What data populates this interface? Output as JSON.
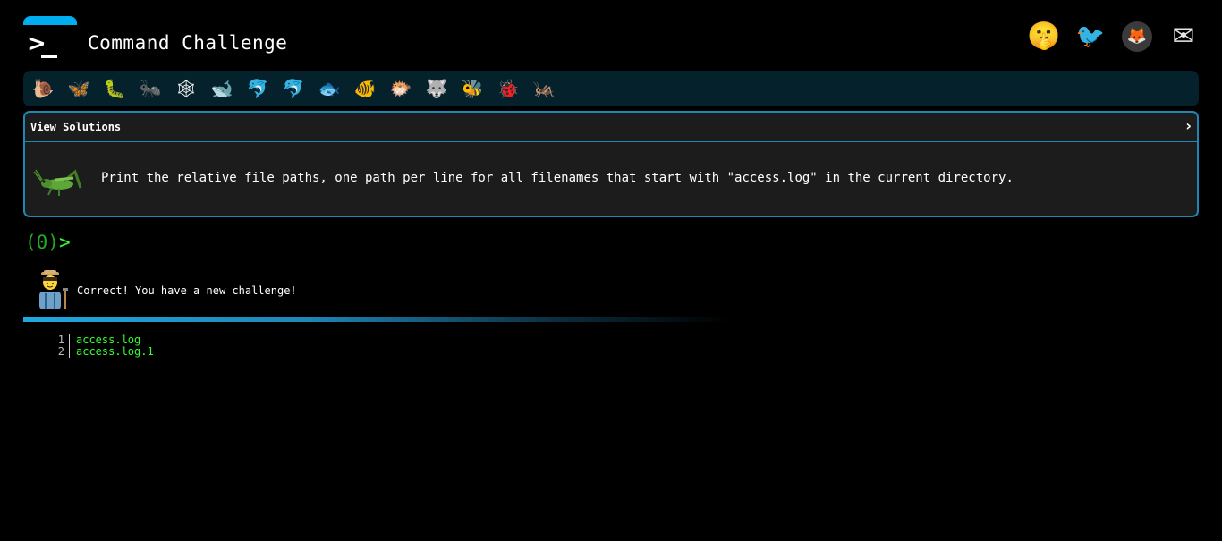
{
  "header": {
    "title": "Command Challenge",
    "social": [
      {
        "name": "shushing-face-icon",
        "glyph": "🤫"
      },
      {
        "name": "twitter-icon",
        "glyph": "🐦"
      },
      {
        "name": "gitlab-icon",
        "glyph": "🦊"
      },
      {
        "name": "mail-icon",
        "glyph": "✉"
      }
    ]
  },
  "critters": [
    {
      "name": "snail-icon",
      "glyph": "🐌"
    },
    {
      "name": "butterfly-icon",
      "glyph": "🦋"
    },
    {
      "name": "bug-icon",
      "glyph": "🐛"
    },
    {
      "name": "ant-icon",
      "glyph": "🐜"
    },
    {
      "name": "spiderweb-icon",
      "glyph": "🕸"
    },
    {
      "name": "whale-icon",
      "glyph": "🐋"
    },
    {
      "name": "dolphin-icon",
      "glyph": "🐬"
    },
    {
      "name": "dolphin-2-icon",
      "glyph": "🐬"
    },
    {
      "name": "fish-icon",
      "glyph": "🐟"
    },
    {
      "name": "tropical-fish-icon",
      "glyph": "🐠"
    },
    {
      "name": "blowfish-icon",
      "glyph": "🐡"
    },
    {
      "name": "wolf-icon",
      "glyph": "🐺"
    },
    {
      "name": "bee-icon",
      "glyph": "🐝"
    },
    {
      "name": "ladybug-icon",
      "glyph": "🐞"
    },
    {
      "name": "cricket-icon",
      "glyph": "🦗"
    }
  ],
  "challenge": {
    "toggle_label": "View Solutions",
    "toggle_chevron": "›",
    "text": "Print the relative file paths, one path per line for all filenames that start with \"access.log\" in the current directory."
  },
  "prompt": {
    "count": "(0)",
    "caret": ">"
  },
  "response": {
    "message": "Correct! You have a new challenge!"
  },
  "output": {
    "lines": [
      {
        "num": "1",
        "text": "access.log"
      },
      {
        "num": "2",
        "text": "access.log.1"
      }
    ]
  },
  "colors": {
    "accent": "#00aef0",
    "panel_border": "#1f86b8",
    "prompt_green": "#33ff33",
    "strip_bg": "#05222c"
  }
}
